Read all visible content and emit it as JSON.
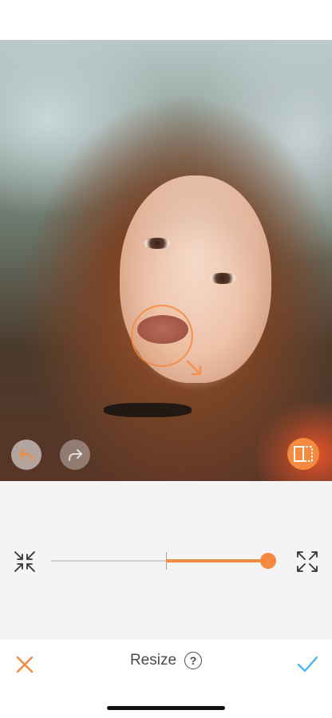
{
  "editor": {
    "tool_title": "Resize",
    "help_symbol": "?"
  },
  "slider": {
    "value_percent": 100,
    "center_percent": 53
  },
  "colors": {
    "accent": "#f28a3f",
    "check": "#4db6f0",
    "cancel": "#f28a3f"
  },
  "icons": {
    "undo": "undo-icon",
    "redo": "redo-icon",
    "compare": "compare-icon",
    "shrink": "shrink-arrows-icon",
    "expand": "expand-arrows-icon",
    "cancel": "close-icon",
    "confirm": "checkmark-icon",
    "help": "help-icon"
  }
}
